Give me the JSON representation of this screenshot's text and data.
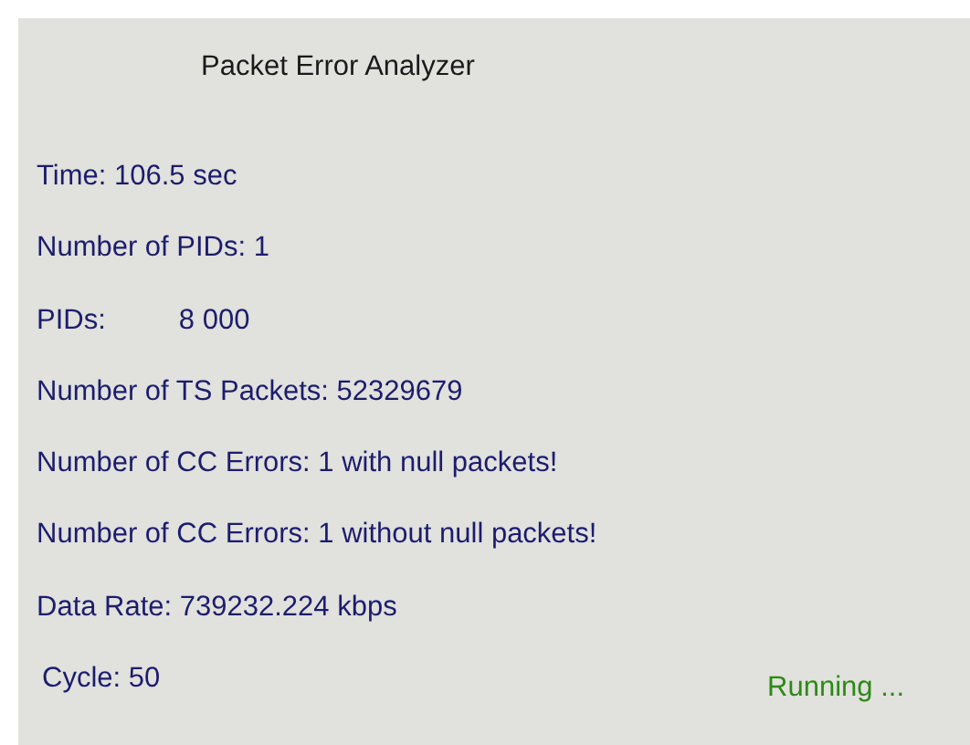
{
  "title": "Packet Error Analyzer",
  "lines": [
    {
      "kind": "text",
      "text": "Time: 106.5 sec"
    },
    {
      "kind": "text",
      "text": "Number of PIDs: 1"
    },
    {
      "kind": "pair",
      "label": "PIDs:",
      "value": "8 000"
    },
    {
      "kind": "text",
      "text": "Number of TS Packets: 52329679"
    },
    {
      "kind": "text",
      "text": "Number of CC Errors: 1 with null packets!"
    },
    {
      "kind": "text",
      "text": "Number of CC Errors: 1 without null packets!"
    },
    {
      "kind": "text",
      "text": "Data Rate: 739232.224 kbps"
    }
  ],
  "cycle": "Cycle: 50",
  "status": "Running ..."
}
